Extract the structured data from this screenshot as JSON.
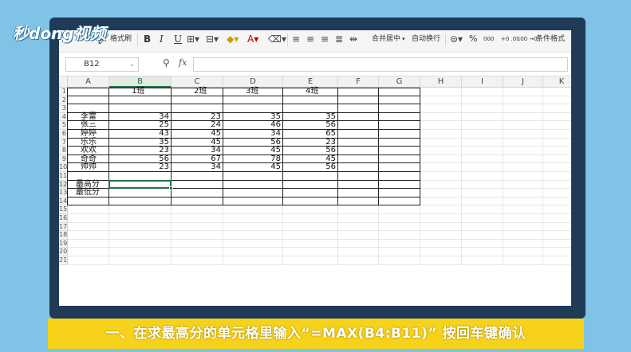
{
  "logo": {
    "text": "秒dong视频"
  },
  "ribbon": {
    "format_painter": "格式刷",
    "bold": "B",
    "italic": "I",
    "underline": "U",
    "merge_center": "合并居中",
    "wrap_text": "自动换行",
    "percent": "%",
    "thousands": "000",
    "increase_decimal": "+0 .00",
    "decrease_decimal": ".00 →0",
    "conditional_format": "条件格式"
  },
  "formula_bar": {
    "name_box": "B12",
    "fx": "fx",
    "formula": ""
  },
  "columns": [
    "A",
    "B",
    "C",
    "D",
    "E",
    "F",
    "G",
    "H",
    "I",
    "J",
    "K"
  ],
  "selected_column": "B",
  "selected_row": "12",
  "rows": [
    "1",
    "2",
    "3",
    "4",
    "5",
    "6",
    "7",
    "8",
    "9",
    "10",
    "11",
    "12",
    "13",
    "14",
    "15",
    "16",
    "17",
    "18",
    "19",
    "20",
    "21"
  ],
  "table": {
    "headers": [
      "1班",
      "2班",
      "3班",
      "4班"
    ],
    "students": [
      {
        "name": "李雷",
        "values": [
          "34",
          "23",
          "35",
          "35"
        ]
      },
      {
        "name": "张三",
        "values": [
          "25",
          "24",
          "46",
          "56"
        ]
      },
      {
        "name": "婷婷",
        "values": [
          "43",
          "45",
          "34",
          "65"
        ]
      },
      {
        "name": "乐乐",
        "values": [
          "35",
          "45",
          "56",
          "23"
        ]
      },
      {
        "name": "欢欢",
        "values": [
          "23",
          "34",
          "45",
          "56"
        ]
      },
      {
        "name": "奇奇",
        "values": [
          "56",
          "67",
          "78",
          "45"
        ]
      },
      {
        "name": "帅帅",
        "values": [
          "23",
          "34",
          "45",
          "56"
        ]
      }
    ],
    "max_label": "最高分",
    "min_label": "最低分"
  },
  "caption": {
    "text": "一、在求最高分的单元格里输入“=MAX(B4:B11)” 按回车键确认"
  },
  "colors": {
    "background": "#7fc3e6",
    "frame": "#1f3b57",
    "caption_bar": "#f7d21a",
    "accent": "#217346"
  }
}
